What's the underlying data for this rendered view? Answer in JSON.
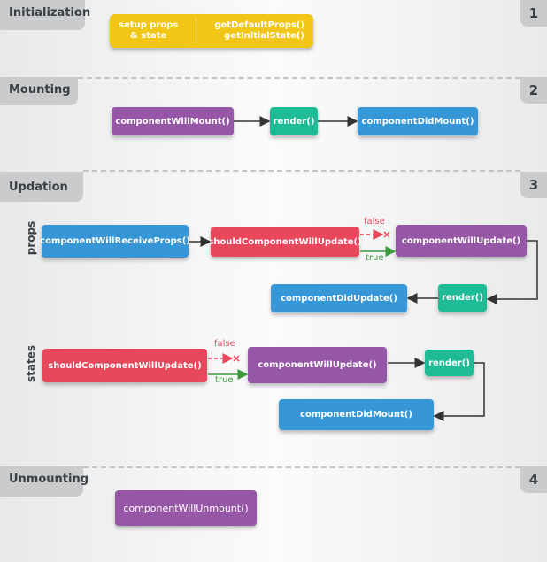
{
  "phases": [
    {
      "name": "Initialization",
      "number": "1"
    },
    {
      "name": "Mounting",
      "number": "2"
    },
    {
      "name": "Updation",
      "number": "3"
    },
    {
      "name": "Unmounting",
      "number": "4"
    }
  ],
  "initialization": {
    "left_text_line1": "setup props",
    "left_text_line2": "& state",
    "right_text_line1": "getDefaultProps()",
    "right_text_line2": "getInitialState()"
  },
  "mounting": {
    "nodes": [
      "componentWillMount()",
      "render()",
      "componentDidMount()"
    ]
  },
  "updation": {
    "props": {
      "label": "props",
      "nodes": [
        "componentWillReceiveProps()",
        "shouldComponentWillUpdate()",
        "componentWillUpdate()",
        "render()",
        "componentDidUpdate()"
      ],
      "false_label": "false",
      "true_label": "true"
    },
    "states": {
      "label": "states",
      "nodes": [
        "shouldComponentWillUpdate()",
        "componentWillUpdate()",
        "render()",
        "componentDidMount()"
      ],
      "false_label": "false",
      "true_label": "true"
    }
  },
  "unmounting": {
    "nodes": [
      "componentWillUnmount()"
    ]
  },
  "colors": {
    "purple": "#9657a6",
    "green": "#1fbb97",
    "blue": "#3797d6",
    "red": "#e8475c",
    "yellow": "#f1c616",
    "false_edge": "#e8475c",
    "true_edge": "#3c9a3c"
  }
}
